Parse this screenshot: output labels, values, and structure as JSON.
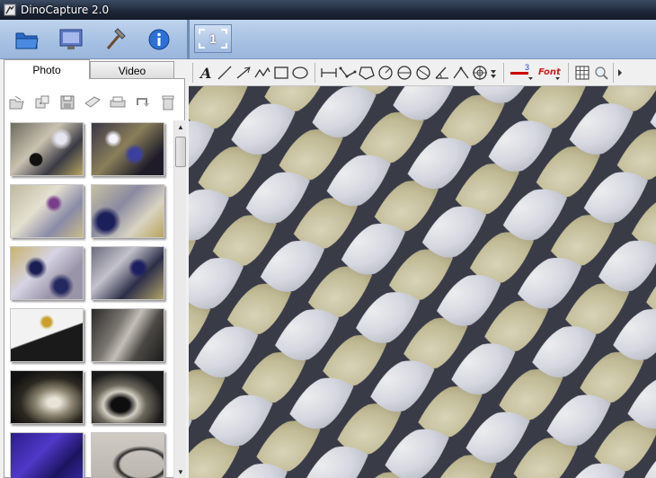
{
  "window": {
    "title": "DinoCapture 2.0"
  },
  "main_toolbar": {
    "buttons": [
      {
        "name": "folder",
        "icon": "folder-icon"
      },
      {
        "name": "monitor",
        "icon": "monitor-icon"
      },
      {
        "name": "tools",
        "icon": "hammer-icon"
      },
      {
        "name": "info",
        "icon": "info-icon"
      }
    ],
    "frame_label": "1"
  },
  "left_panel": {
    "tabs": [
      {
        "label": "Photo",
        "active": true
      },
      {
        "label": "Video",
        "active": false
      }
    ],
    "thumb_tools": [
      "open-icon",
      "dice-icon",
      "save-icon",
      "tag-icon",
      "print-icon",
      "refresh-icon",
      "trash-icon"
    ],
    "thumbnail_count": 12
  },
  "image_toolbar": {
    "tools": [
      "text-icon",
      "line-icon",
      "arrow-icon",
      "freehand-icon",
      "rectangle-icon",
      "ellipse-icon",
      "distance-icon",
      "polyline-icon",
      "polygon-icon",
      "circle-radius-icon",
      "circle-diameter-icon",
      "arc-icon",
      "angle-icon",
      "target-icon",
      "more-icon",
      "line-width-icon",
      "font-icon",
      "grid-icon",
      "zoom-icon"
    ],
    "line_width": "3",
    "font_label": "Font"
  },
  "colors": {
    "title_bar": "#1d2738",
    "strip": "#a8c2e3",
    "line_color": "#d00000"
  }
}
